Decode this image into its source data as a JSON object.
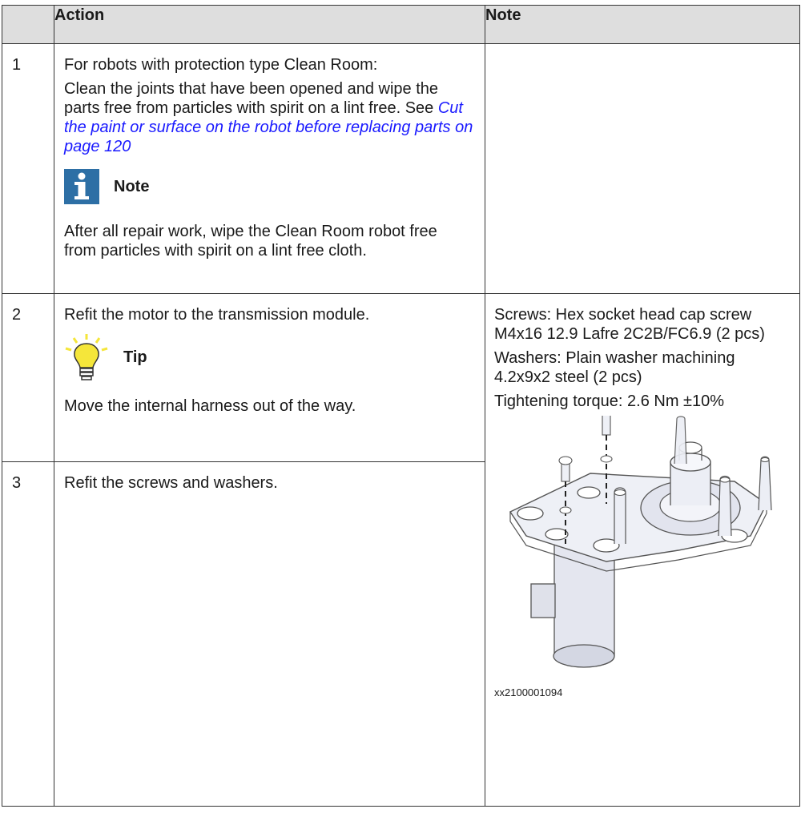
{
  "table": {
    "headers": {
      "number": "",
      "action": "Action",
      "note": "Note"
    },
    "rows": [
      {
        "number": "1",
        "action_paragraphs": [
          "For robots with protection type Clean Room:",
          "Clean the joints that have been opened and wipe the parts free from particles with spirit on a lint free. See "
        ],
        "link_text": "Cut the paint or surface on the robot before replacing parts on page 120",
        "admonition": {
          "icon": "info-note-icon",
          "title": "Note"
        },
        "after_admonition": "After all repair work, wipe the Clean Room robot free from particles with spirit on a lint free cloth."
      },
      {
        "number": "2",
        "action": "Refit the motor to the transmission module.",
        "admonition": {
          "icon": "lightbulb-tip-icon",
          "title": "Tip"
        },
        "after_admonition": "Move the internal harness out of the way.",
        "note_paragraphs": [
          "Screws: Hex socket head cap screw M4x16 12.9 Lafre 2C2B/FC6.9 (2 pcs)",
          "Washers: Plain washer machining 4.2x9x2  steel (2 pcs)",
          "Tightening torque: 2.6 Nm ±10%"
        ]
      },
      {
        "number": "3",
        "action": "Refit the screws and washers.",
        "image_caption": "xx2100001094",
        "image_icon": "motor-assembly-drawing"
      }
    ]
  },
  "colors": {
    "header_bg": "#dedede",
    "link": "#1a1aff",
    "note_icon": "#2d6fa5",
    "tip_icon": "#f5e63a"
  }
}
